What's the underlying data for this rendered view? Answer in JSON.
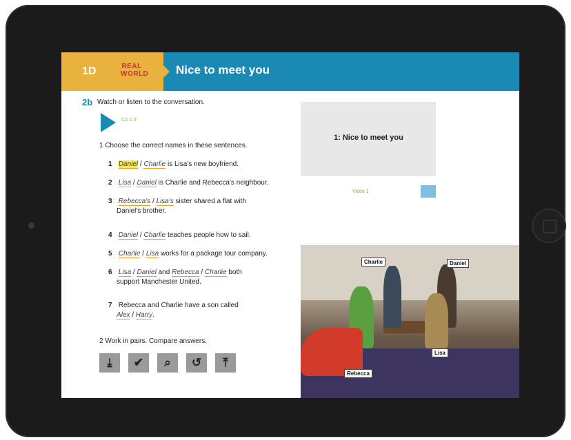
{
  "header": {
    "unit": "1D",
    "badge": "REAL WORLD",
    "title": "Nice to meet you"
  },
  "exercise": {
    "number": "2b",
    "instruction": "Watch or listen to the conversation.",
    "cd_label": "CD 1.5",
    "task1": "1  Choose the correct names in these sentences.",
    "items": [
      {
        "n": "1",
        "a": "Daniel",
        "b": "Charlie",
        "rest": " is Lisa's new boyfriend."
      },
      {
        "n": "2",
        "a": "Lisa",
        "b": "Daniel",
        "rest": " is Charlie and Rebecca's neighbour."
      },
      {
        "n": "3",
        "a": "Rebecca's",
        "b": "Lisa's",
        "rest": " sister shared a flat with",
        "line2": "Daniel's brother."
      },
      {
        "n": "4",
        "a": "Daniel",
        "b": "Charlie",
        "rest": " teaches people how to sail."
      },
      {
        "n": "5",
        "a": "Charlie",
        "b": "Lisa",
        "rest": " works for a package tour company."
      },
      {
        "n": "6",
        "a": "Lisa",
        "b": "Daniel",
        "mid": " and ",
        "c": "Rebecca",
        "d": "Charlie",
        "rest": " both",
        "line2": "support Manchester United."
      },
      {
        "n": "7",
        "text": "Rebecca and Charlie have a son called",
        "a": "Alex",
        "b": "Harry",
        "rest": "."
      }
    ],
    "task2": "2  Work in pairs. Compare answers."
  },
  "tools": [
    {
      "name": "download-icon",
      "glyph": "⤓"
    },
    {
      "name": "check-icon",
      "glyph": "✔"
    },
    {
      "name": "search-check-icon",
      "glyph": "⌕"
    },
    {
      "name": "undo-icon",
      "glyph": "↺"
    },
    {
      "name": "upload-icon",
      "glyph": "⤒"
    }
  ],
  "video": {
    "title": "1: Nice to meet you",
    "label": "Video 1"
  },
  "photo": {
    "tags": [
      "Charlie",
      "Daniel",
      "Lisa",
      "Rebecca"
    ]
  }
}
